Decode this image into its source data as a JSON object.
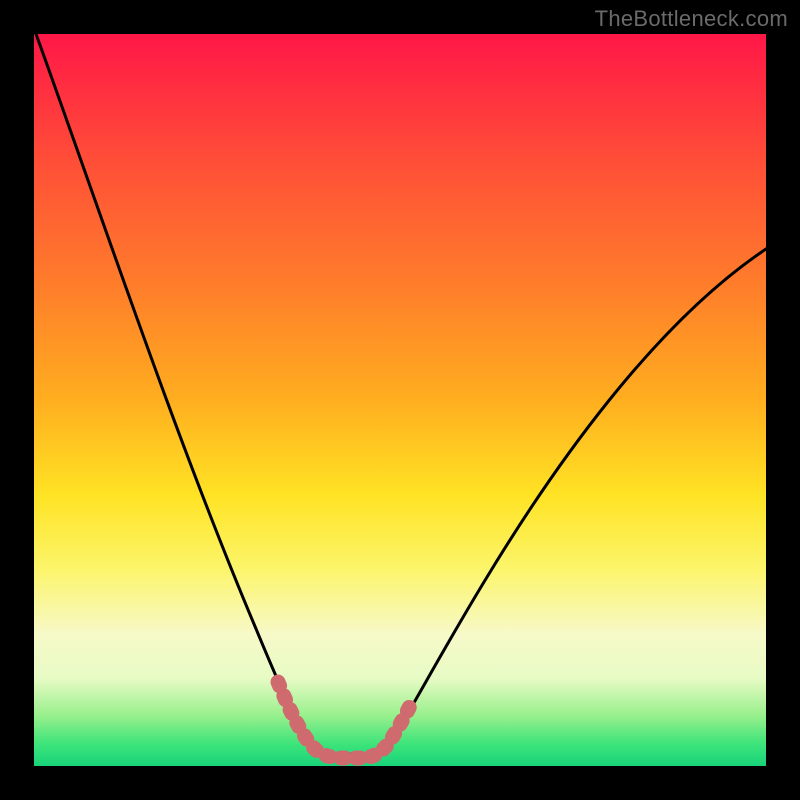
{
  "watermark": "TheBottleneck.com",
  "chart_data": {
    "type": "line",
    "title": "",
    "xlabel": "",
    "ylabel": "",
    "xlim": [
      0,
      100
    ],
    "ylim": [
      0,
      100
    ],
    "x": [
      0,
      5,
      10,
      15,
      20,
      25,
      30,
      32,
      34,
      36,
      38,
      40,
      42,
      44,
      46,
      48,
      50,
      55,
      60,
      65,
      70,
      75,
      80,
      85,
      90,
      95,
      100
    ],
    "y": [
      100,
      86,
      72,
      58,
      44,
      31,
      18,
      13,
      9,
      5,
      3,
      3,
      3,
      5,
      8,
      12,
      16,
      24,
      32,
      40,
      47,
      54,
      60,
      66,
      71,
      76,
      80
    ],
    "minimum_x": 40,
    "minimum_y": 3,
    "highlight_band": {
      "x_start": 33,
      "x_end": 48
    },
    "gradient_stops": [
      {
        "pos": 0.0,
        "color": "#ff1747"
      },
      {
        "pos": 0.18,
        "color": "#ff5037"
      },
      {
        "pos": 0.35,
        "color": "#ff7f2a"
      },
      {
        "pos": 0.5,
        "color": "#ffae1f"
      },
      {
        "pos": 0.63,
        "color": "#ffe324"
      },
      {
        "pos": 0.73,
        "color": "#fcf56a"
      },
      {
        "pos": 0.82,
        "color": "#f7f9c8"
      },
      {
        "pos": 0.88,
        "color": "#e7fbc5"
      },
      {
        "pos": 0.93,
        "color": "#9af08d"
      },
      {
        "pos": 0.97,
        "color": "#3de47a"
      },
      {
        "pos": 1.0,
        "color": "#18d37a"
      }
    ],
    "colors": {
      "curve": "#000000",
      "highlight": "#cf6a6e",
      "frame": "#000000"
    }
  }
}
